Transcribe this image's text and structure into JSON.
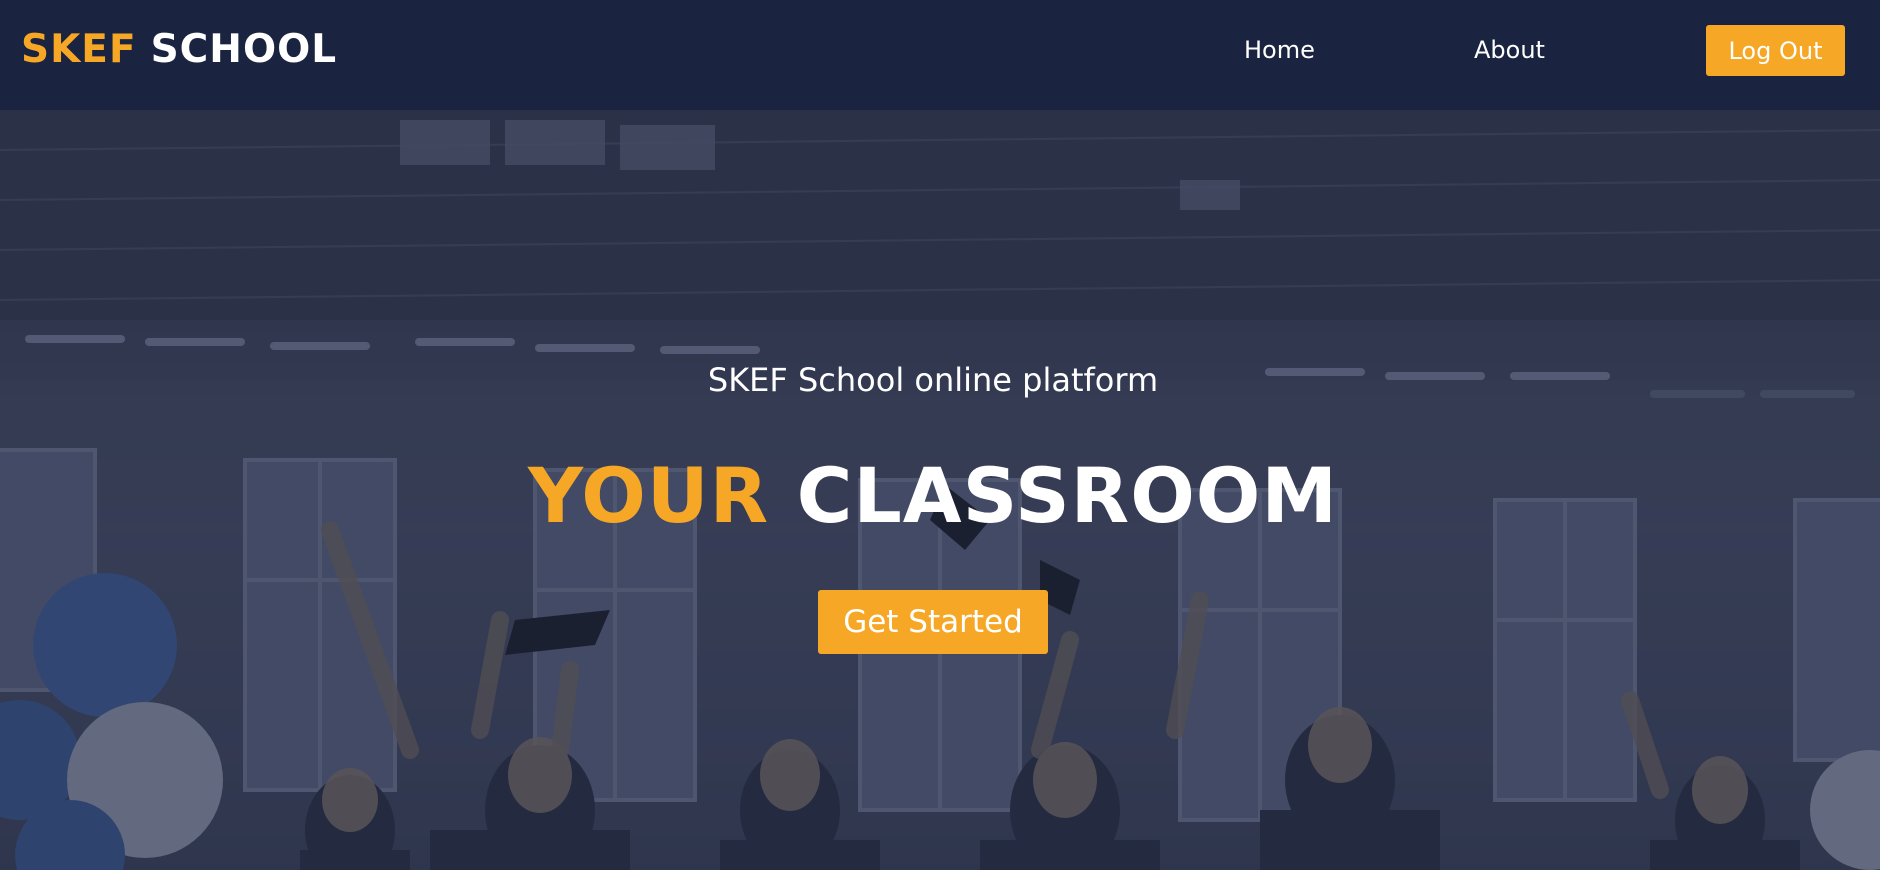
{
  "brand": {
    "accent_word": "SKEF",
    "main_word": "SCHOOL"
  },
  "nav": {
    "home_label": "Home",
    "about_label": "About",
    "logout_label": "Log Out"
  },
  "hero": {
    "subtitle": "SKEF School online platform",
    "title_accent": "YOUR",
    "title_main": "CLASSROOM",
    "cta_label": "Get Started"
  },
  "colors": {
    "navbar_bg": "#1a2340",
    "accent": "#f6a726",
    "text": "#ffffff"
  },
  "icons": {
    "hero_image": "graduation-photo"
  }
}
